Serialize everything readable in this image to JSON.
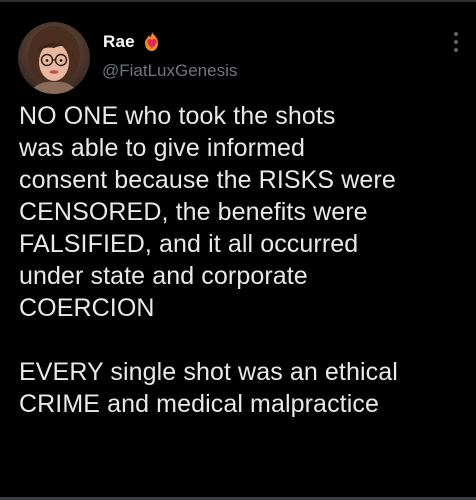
{
  "tweet": {
    "display_name": "Rae",
    "badge_icon": "fire-heart-icon",
    "handle": "@FiatLuxGenesis",
    "paragraphs": [
      [
        "NO ONE who took the shots",
        "was able to give informed",
        "consent because the RISKS were",
        "CENSORED, the benefits were",
        "FALSIFIED, and it all occurred",
        "under state and corporate",
        "COERCION"
      ],
      [
        "EVERY single shot was an ethical",
        "CRIME and medical malpractice"
      ]
    ]
  },
  "colors": {
    "background": "#000000",
    "text": "#e7e9ea",
    "handle": "#71767b",
    "badge": "#e0245e"
  }
}
